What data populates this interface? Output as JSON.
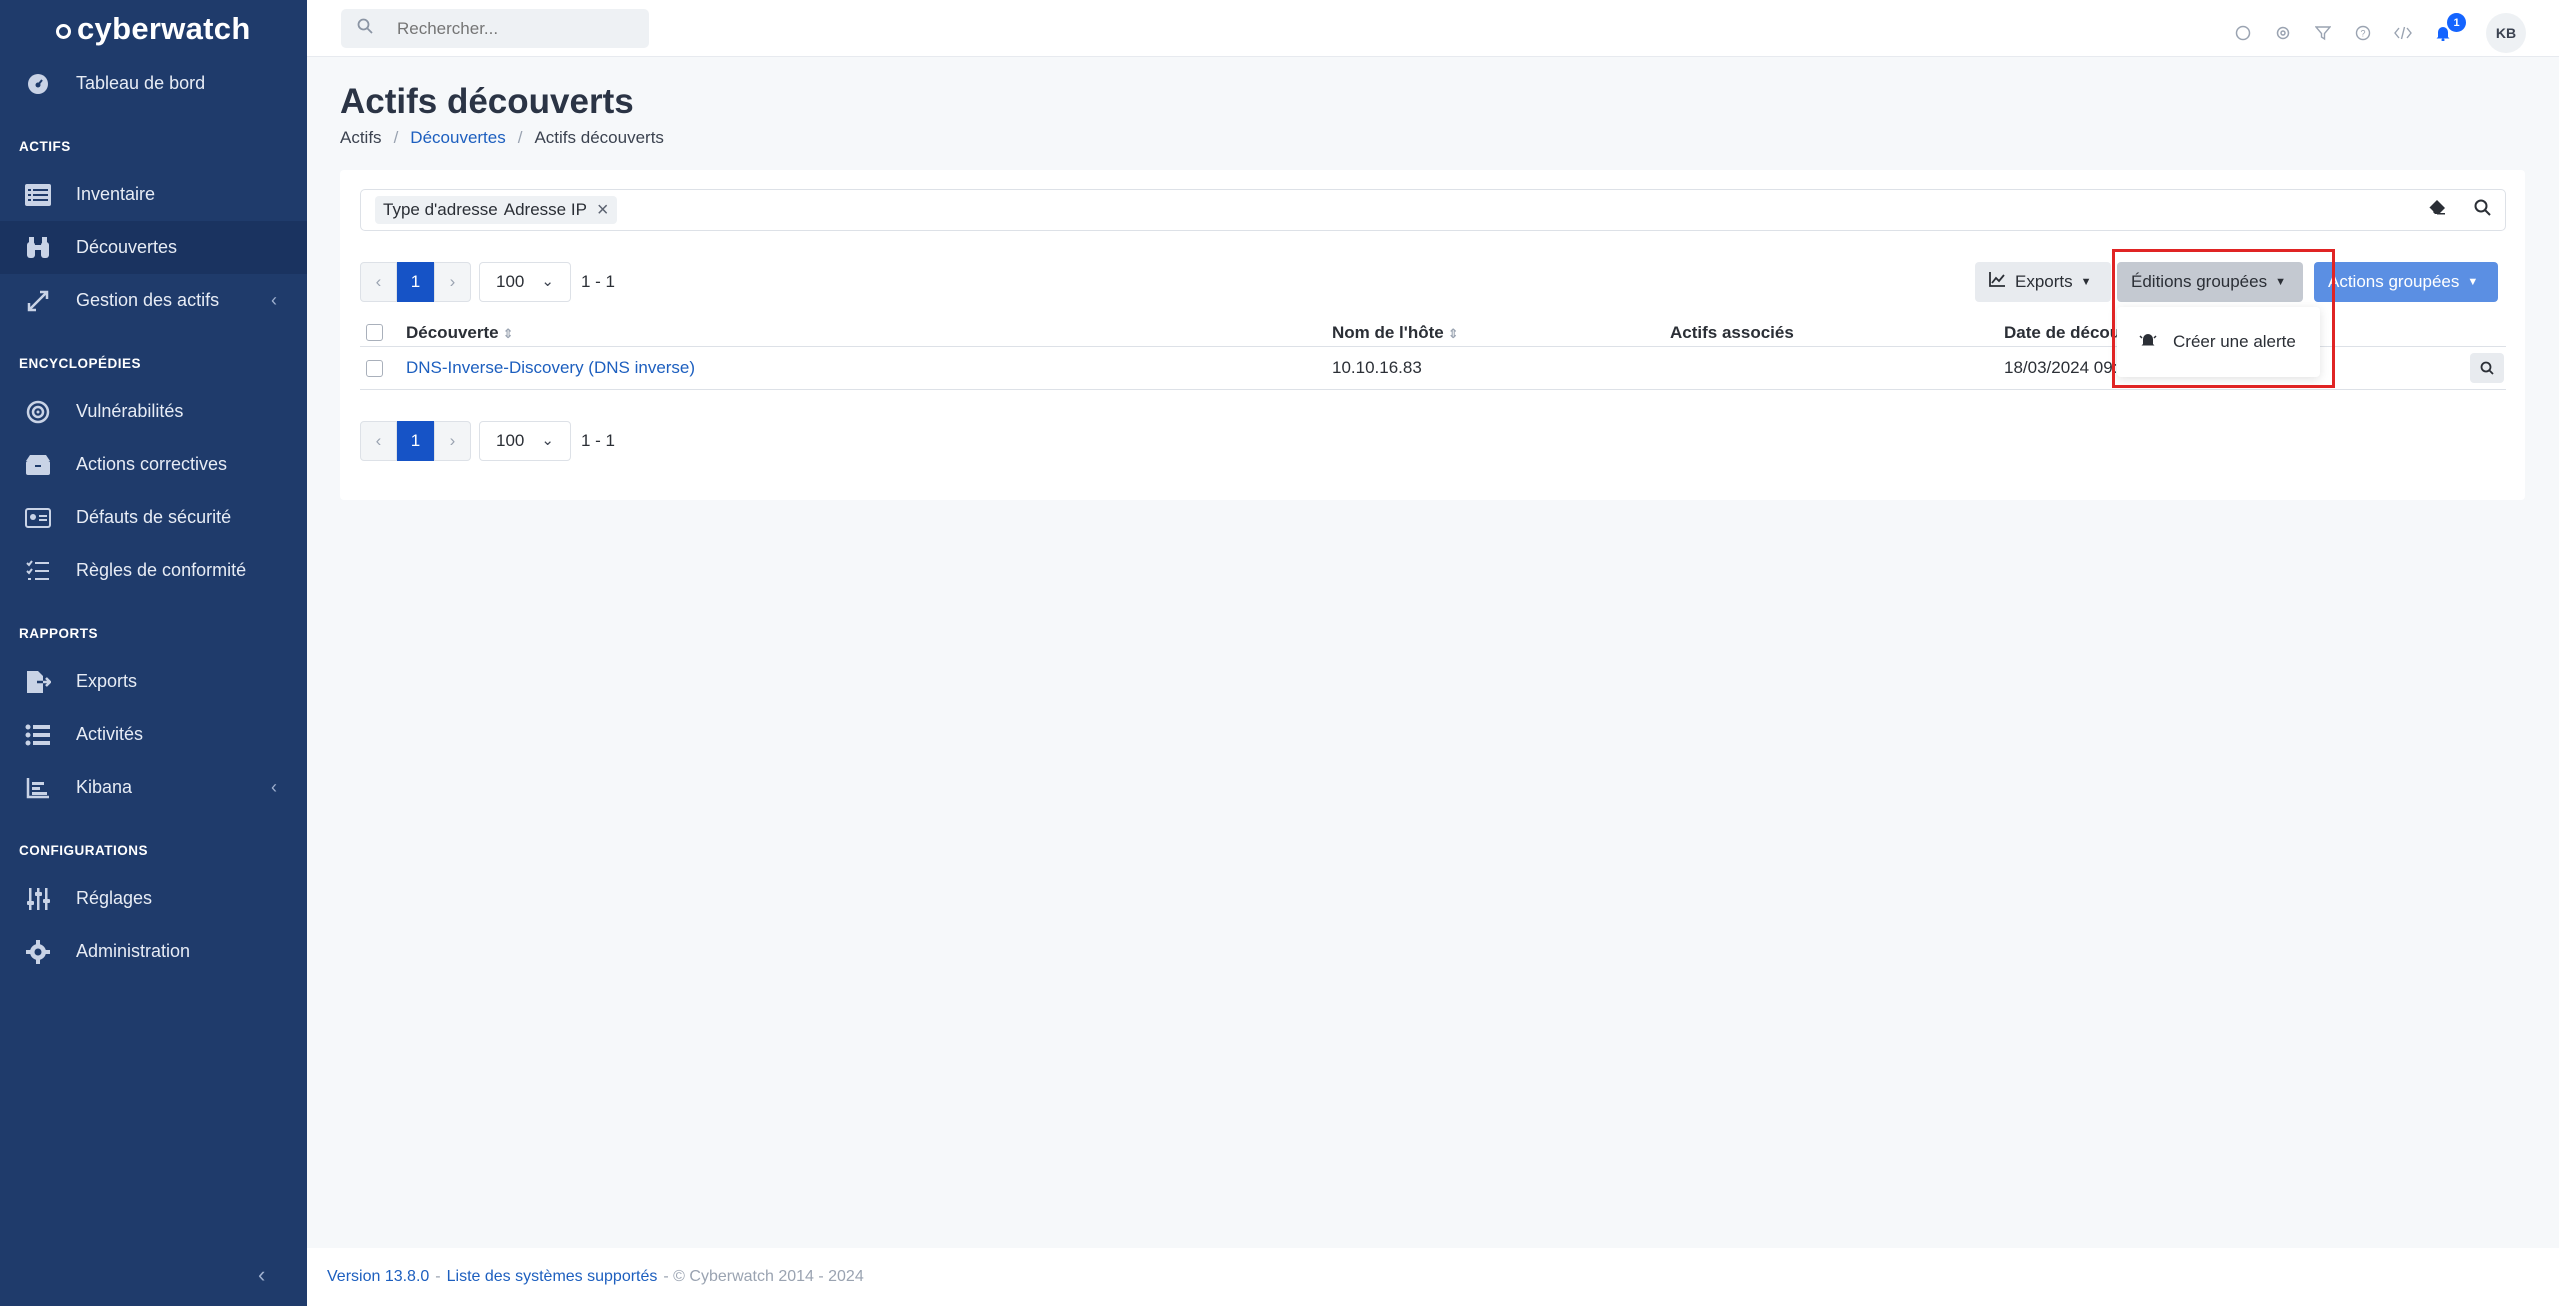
{
  "sidebar": {
    "brand": "cyberwatch",
    "items": {
      "dashboard": "Tableau de bord",
      "inventory": "Inventaire",
      "discoveries": "Découvertes",
      "asset_mgmt": "Gestion des actifs",
      "vulns": "Vulnérabilités",
      "remediation": "Actions correctives",
      "security_flaws": "Défauts de sécurité",
      "compliance": "Règles de conformité",
      "exports": "Exports",
      "activities": "Activités",
      "kibana": "Kibana",
      "settings": "Réglages",
      "admin": "Administration"
    },
    "sections": {
      "actifs": "ACTIFS",
      "encyclopedies": "ENCYCLOPÉDIES",
      "rapports": "RAPPORTS",
      "configurations": "CONFIGURATIONS"
    }
  },
  "topbar": {
    "search_placeholder": "Rechercher...",
    "notif_count": "1",
    "avatar_initials": "KB"
  },
  "page": {
    "title": "Actifs découverts",
    "breadcrumb": [
      "Actifs",
      "Découvertes",
      "Actifs découverts"
    ]
  },
  "filter": {
    "chip_key": "Type d'adresse",
    "chip_value": "Adresse IP"
  },
  "pagination": {
    "prev": "‹",
    "current": "1",
    "next": "›",
    "per_page": "100",
    "range": "1 - 1"
  },
  "buttons": {
    "exports": "Exports",
    "editions": "Éditions groupées",
    "actions": "Actions groupées"
  },
  "dropdown": {
    "create_alert": "Créer une alerte"
  },
  "table": {
    "headers": {
      "discovery": "Découverte",
      "hostname": "Nom de l'hôte",
      "assets": "Actifs associés",
      "date": "Date de décou"
    },
    "rows": [
      {
        "discovery": "DNS-Inverse-Discovery (DNS inverse)",
        "hostname": "10.10.16.83",
        "assets": "",
        "date": "18/03/2024 09:5"
      }
    ]
  },
  "footer": {
    "version": "Version 13.8.0",
    "sep": "-",
    "supported": "Liste des systèmes supportés",
    "copyright": "- © Cyberwatch 2014 - 2024"
  }
}
